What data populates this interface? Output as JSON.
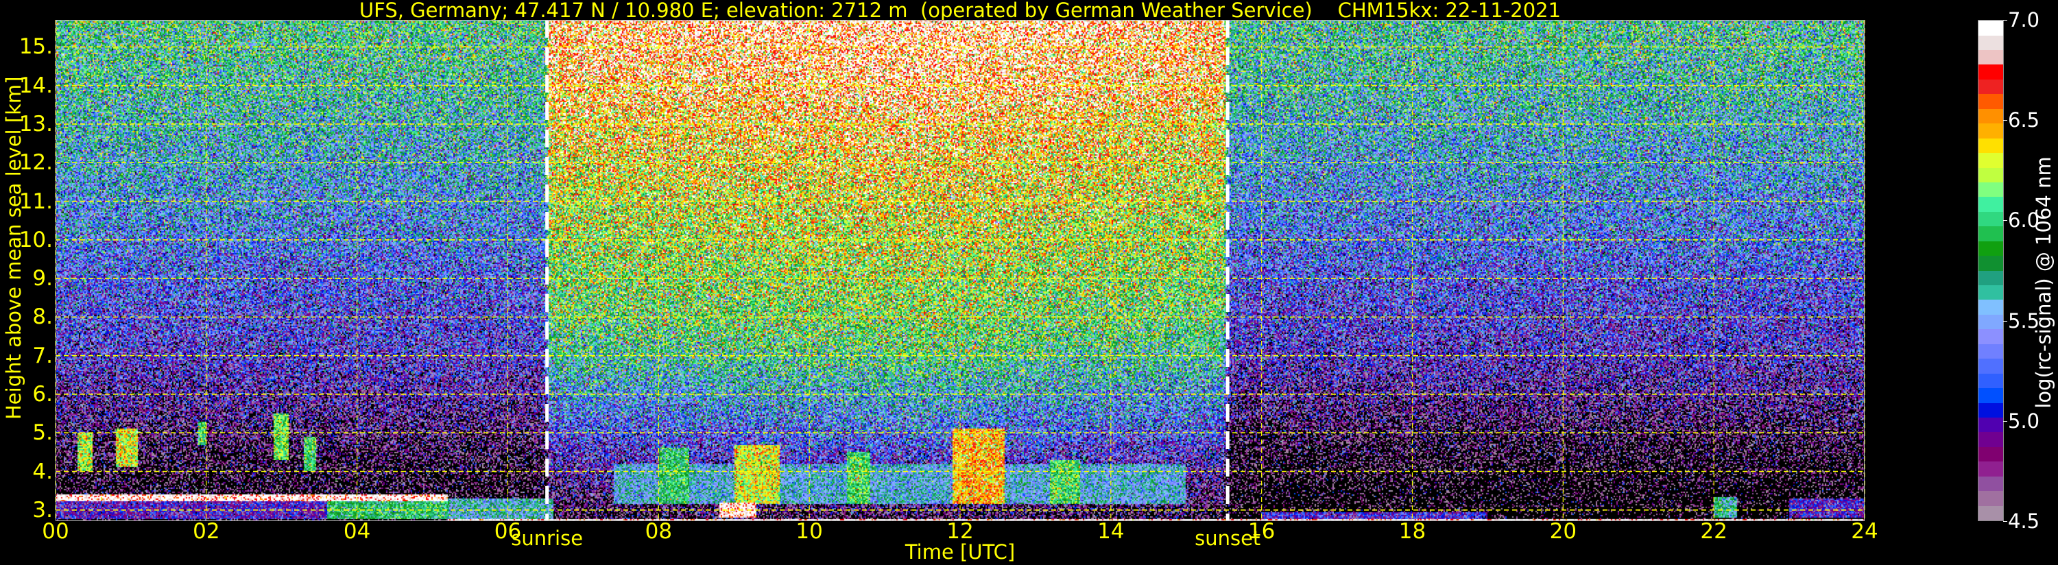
{
  "title": "UFS, Germany; 47.417 N / 10.980 E; elevation: 2712 m  (operated by German Weather Service)    CHM15kx: 22-11-2021",
  "chart_data": {
    "type": "heatmap",
    "title": "UFS, Germany; 47.417 N / 10.980 E; elevation: 2712 m  (operated by German Weather Service)    CHM15kx: 22-11-2021",
    "xlabel": "Time [UTC]",
    "ylabel": "Height above mean sea level [km]",
    "xlim": [
      0,
      24
    ],
    "ylim": [
      2.712,
      15.7
    ],
    "xticks": [
      0,
      2,
      4,
      6,
      8,
      10,
      12,
      14,
      16,
      18,
      20,
      22,
      24
    ],
    "xtick_labels": [
      "00",
      "02",
      "04",
      "06",
      "08",
      "10",
      "12",
      "14",
      "16",
      "18",
      "20",
      "22",
      "24"
    ],
    "yticks": [
      3,
      4,
      5,
      6,
      7,
      8,
      9,
      10,
      11,
      12,
      13,
      14,
      15
    ],
    "ytick_labels": [
      "3.",
      "4.",
      "5.",
      "6.",
      "7.",
      "8.",
      "9.",
      "10.",
      "11.",
      "12.",
      "13.",
      "14.",
      "15."
    ],
    "grid": true,
    "grid_color": "#ffff00",
    "events": [
      {
        "label": "sunrise",
        "time": 6.52
      },
      {
        "label": "sunset",
        "time": 15.55
      }
    ],
    "colorbar": {
      "label": "log(rc-signal) @ 1064 nm",
      "range": [
        4.5,
        7.0
      ],
      "ticks": [
        4.5,
        5.0,
        5.5,
        6.0,
        6.5,
        7.0
      ],
      "tick_labels": [
        "4.5",
        "5.0",
        "5.5",
        "6.0",
        "6.5",
        "7.0"
      ],
      "colors_bottom_to_top": [
        "#a890a8",
        "#a070a0",
        "#9050a0",
        "#902090",
        "#800070",
        "#700090",
        "#5000b0",
        "#0010e0",
        "#0050ff",
        "#3060ff",
        "#5070ff",
        "#7080ff",
        "#8c90ff",
        "#80a8ff",
        "#80c0ff",
        "#30c0a0",
        "#20a080",
        "#109030",
        "#10a010",
        "#20c050",
        "#30d880",
        "#40f0a0",
        "#80ff80",
        "#c0ff40",
        "#e0ff30",
        "#ffe000",
        "#ffb000",
        "#ff9000",
        "#ff5a00",
        "#ee2222",
        "#ff0000",
        "#edc4c4",
        "#ece0e0",
        "#ffffff"
      ]
    },
    "background_profile": {
      "heights_km": [
        2.712,
        3,
        4,
        5,
        6,
        7,
        8,
        9,
        10,
        11,
        12,
        13,
        14,
        15.7
      ],
      "times_h": [
        0,
        6.5,
        6.55,
        11.5,
        15.5,
        15.55,
        24
      ],
      "values": [
        [
          4.2,
          4.3,
          4.4,
          4.6,
          4.8,
          5.0,
          5.1,
          5.2,
          5.35,
          5.45,
          5.55,
          5.65,
          5.75,
          5.85
        ],
        [
          4.2,
          4.3,
          4.4,
          4.6,
          4.8,
          5.0,
          5.1,
          5.2,
          5.35,
          5.45,
          5.55,
          5.65,
          5.75,
          5.85
        ],
        [
          4.4,
          4.5,
          4.8,
          5.15,
          5.45,
          5.75,
          5.95,
          6.05,
          6.15,
          6.25,
          6.35,
          6.45,
          6.6,
          6.75
        ],
        [
          4.5,
          4.6,
          4.9,
          5.3,
          5.6,
          5.9,
          6.1,
          6.2,
          6.3,
          6.4,
          6.5,
          6.6,
          6.75,
          6.9
        ],
        [
          4.4,
          4.5,
          4.8,
          5.15,
          5.45,
          5.75,
          5.95,
          6.05,
          6.15,
          6.25,
          6.35,
          6.45,
          6.6,
          6.75
        ],
        [
          4.1,
          4.2,
          4.3,
          4.5,
          4.75,
          4.95,
          5.05,
          5.15,
          5.3,
          5.4,
          5.5,
          5.6,
          5.7,
          5.8
        ],
        [
          4.1,
          4.2,
          4.3,
          4.5,
          4.75,
          4.95,
          5.05,
          5.15,
          5.3,
          5.4,
          5.5,
          5.6,
          5.7,
          5.8
        ]
      ]
    },
    "features": [
      {
        "t": [
          0,
          3.6
        ],
        "h": [
          2.75,
          3.22
        ],
        "value": 4.95
      },
      {
        "t": [
          0,
          5.2
        ],
        "h": [
          3.22,
          3.42
        ],
        "value": 6.95
      },
      {
        "t": [
          3.6,
          5.2
        ],
        "h": [
          2.75,
          3.22
        ],
        "value": 5.85
      },
      {
        "t": [
          0.3,
          0.5
        ],
        "h": [
          4.0,
          5.0
        ],
        "value": 6.2
      },
      {
        "t": [
          0.8,
          1.1
        ],
        "h": [
          4.1,
          5.1
        ],
        "value": 6.3
      },
      {
        "t": [
          1.9,
          2.0
        ],
        "h": [
          4.7,
          5.3
        ],
        "value": 6.0
      },
      {
        "t": [
          2.9,
          3.1
        ],
        "h": [
          4.3,
          5.5
        ],
        "value": 6.1
      },
      {
        "t": [
          3.3,
          3.45
        ],
        "h": [
          4.0,
          4.9
        ],
        "value": 6.0
      },
      {
        "t": [
          5.2,
          6.6
        ],
        "h": [
          2.75,
          3.3
        ],
        "value": 5.6
      },
      {
        "t": [
          7.4,
          15.0
        ],
        "h": [
          3.15,
          4.2
        ],
        "value": 5.55
      },
      {
        "t": [
          8.0,
          8.4
        ],
        "h": [
          3.15,
          4.6
        ],
        "value": 5.9
      },
      {
        "t": [
          9.0,
          9.6
        ],
        "h": [
          3.15,
          4.7
        ],
        "value": 6.3
      },
      {
        "t": [
          10.5,
          10.8
        ],
        "h": [
          3.15,
          4.5
        ],
        "value": 6.0
      },
      {
        "t": [
          11.9,
          12.6
        ],
        "h": [
          3.15,
          5.1
        ],
        "value": 6.45
      },
      {
        "t": [
          13.2,
          13.6
        ],
        "h": [
          3.15,
          4.3
        ],
        "value": 6.0
      },
      {
        "t": [
          8.8,
          9.3
        ],
        "h": [
          2.8,
          3.2
        ],
        "value": 6.9
      },
      {
        "t": [
          5.2,
          24
        ],
        "h": [
          2.712,
          2.78
        ],
        "value": 6.95
      },
      {
        "t": [
          16,
          19
        ],
        "h": [
          2.78,
          2.95
        ],
        "value": 5.0
      },
      {
        "t": [
          22.0,
          22.3
        ],
        "h": [
          2.8,
          3.35
        ],
        "value": 5.7
      },
      {
        "t": [
          23.0,
          24.0
        ],
        "h": [
          2.8,
          3.3
        ],
        "value": 4.95
      }
    ]
  }
}
